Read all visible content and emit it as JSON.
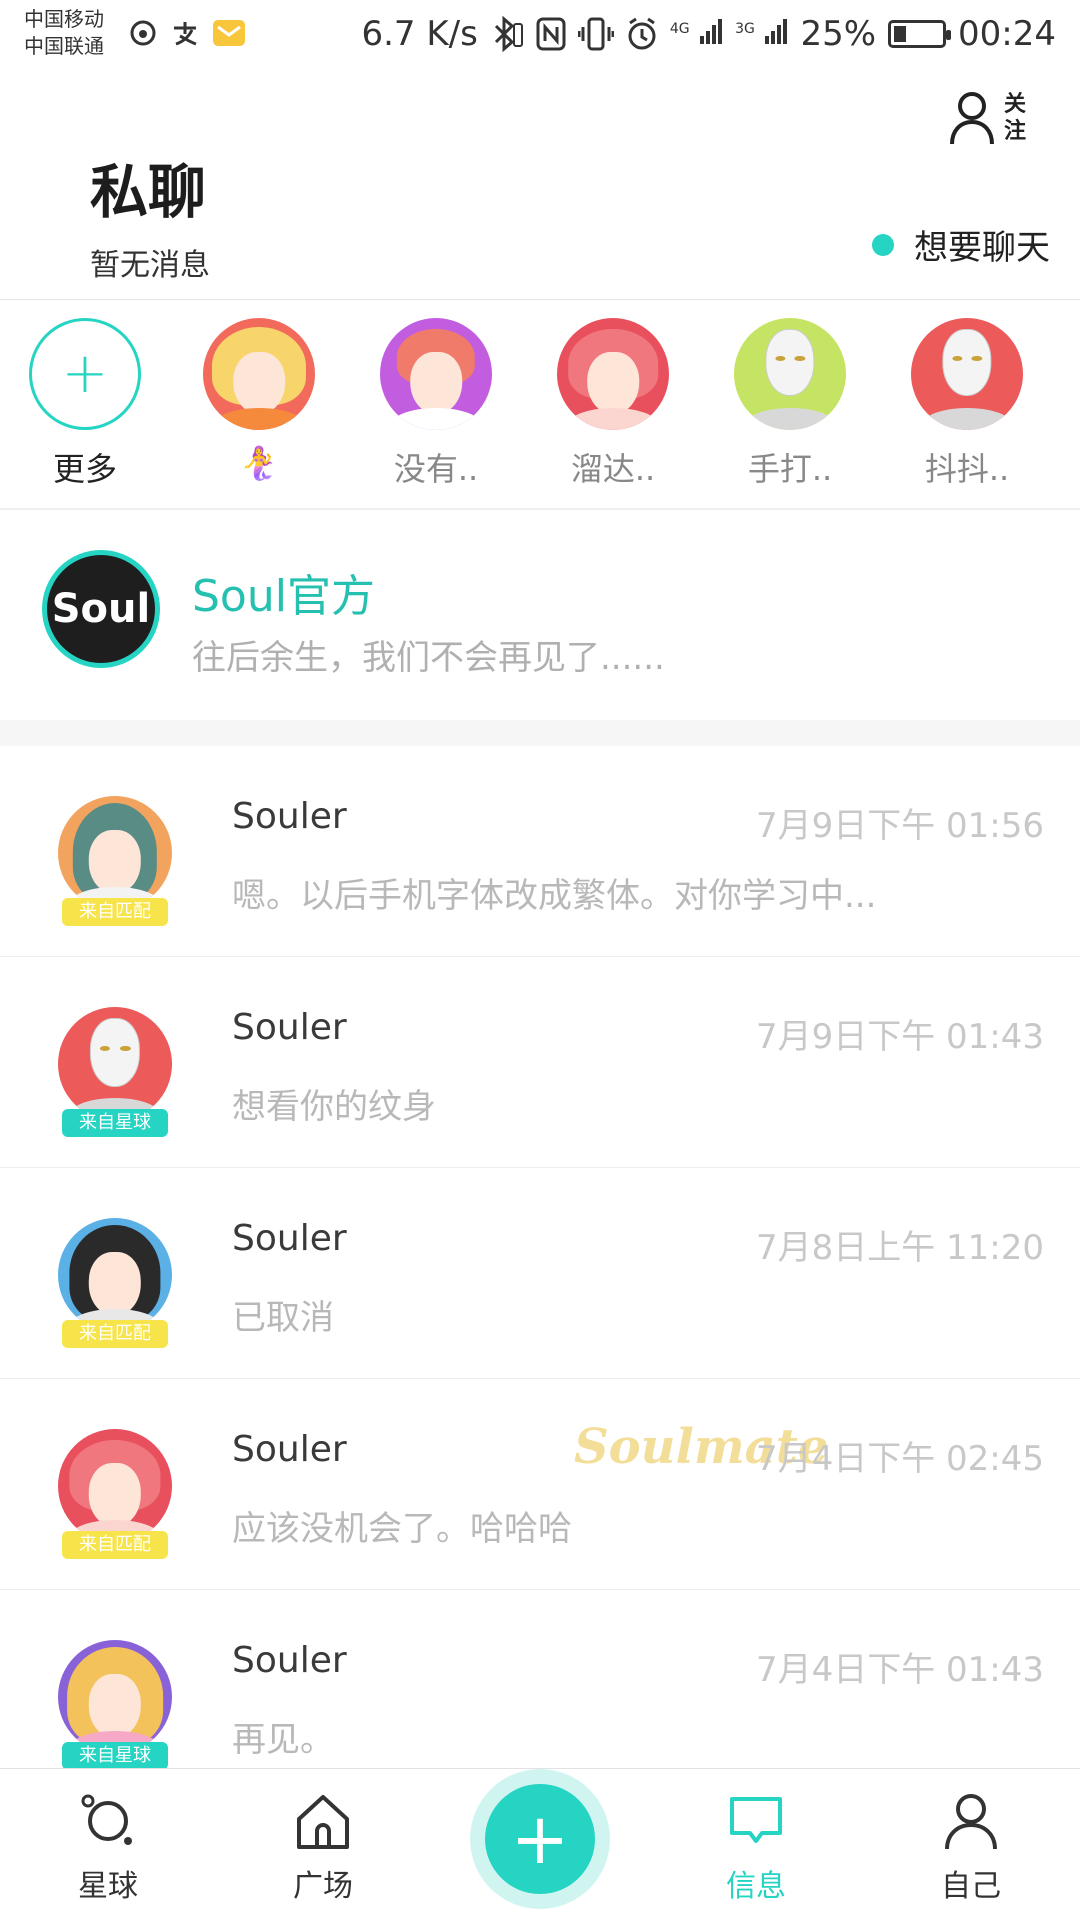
{
  "status_bar": {
    "carrier1": "中国移动",
    "carrier2": "中国联通",
    "net_speed": "6.7 K/s",
    "signal1": "4G",
    "signal2": "3G",
    "battery": "25%",
    "battery_level": 0.25,
    "time": "00:24"
  },
  "header": {
    "title": "私聊",
    "subtitle": "暂无消息",
    "follow_label": "关注",
    "want_chat": "想要聊天"
  },
  "stories": {
    "more_label": "更多",
    "items": [
      {
        "label": "🧜‍♀️"
      },
      {
        "label": "没有.."
      },
      {
        "label": "溜达.."
      },
      {
        "label": "手打.."
      },
      {
        "label": "抖抖.."
      }
    ]
  },
  "official": {
    "avatar_text": "Soul",
    "name": "Soul官方",
    "preview": "往后余生，我们不会再见了......"
  },
  "chats": [
    {
      "name": "Souler",
      "time": "7月9日下午 01:56",
      "message": "嗯。以后手机字体改成繁体。对你学习中...",
      "badge": "来自匹配"
    },
    {
      "name": "Souler",
      "time": "7月9日下午 01:43",
      "message": "想看你的纹身",
      "badge": "来自星球"
    },
    {
      "name": "Souler",
      "time": "7月8日上午 11:20",
      "message": "已取消",
      "badge": "来自匹配"
    },
    {
      "name": "Souler",
      "time": "7月4日下午 02:45",
      "message": "应该没机会了。哈哈哈",
      "badge": "来自匹配"
    },
    {
      "name": "Souler",
      "time": "7月4日下午 01:43",
      "message": "再见。",
      "badge": "来自星球"
    }
  ],
  "watermark": "Soulmate",
  "nav": {
    "planet": "星球",
    "square": "广场",
    "messages": "信息",
    "me": "自己"
  },
  "colors": {
    "accent": "#25d4c2",
    "badge_match": "#f7e34a"
  }
}
